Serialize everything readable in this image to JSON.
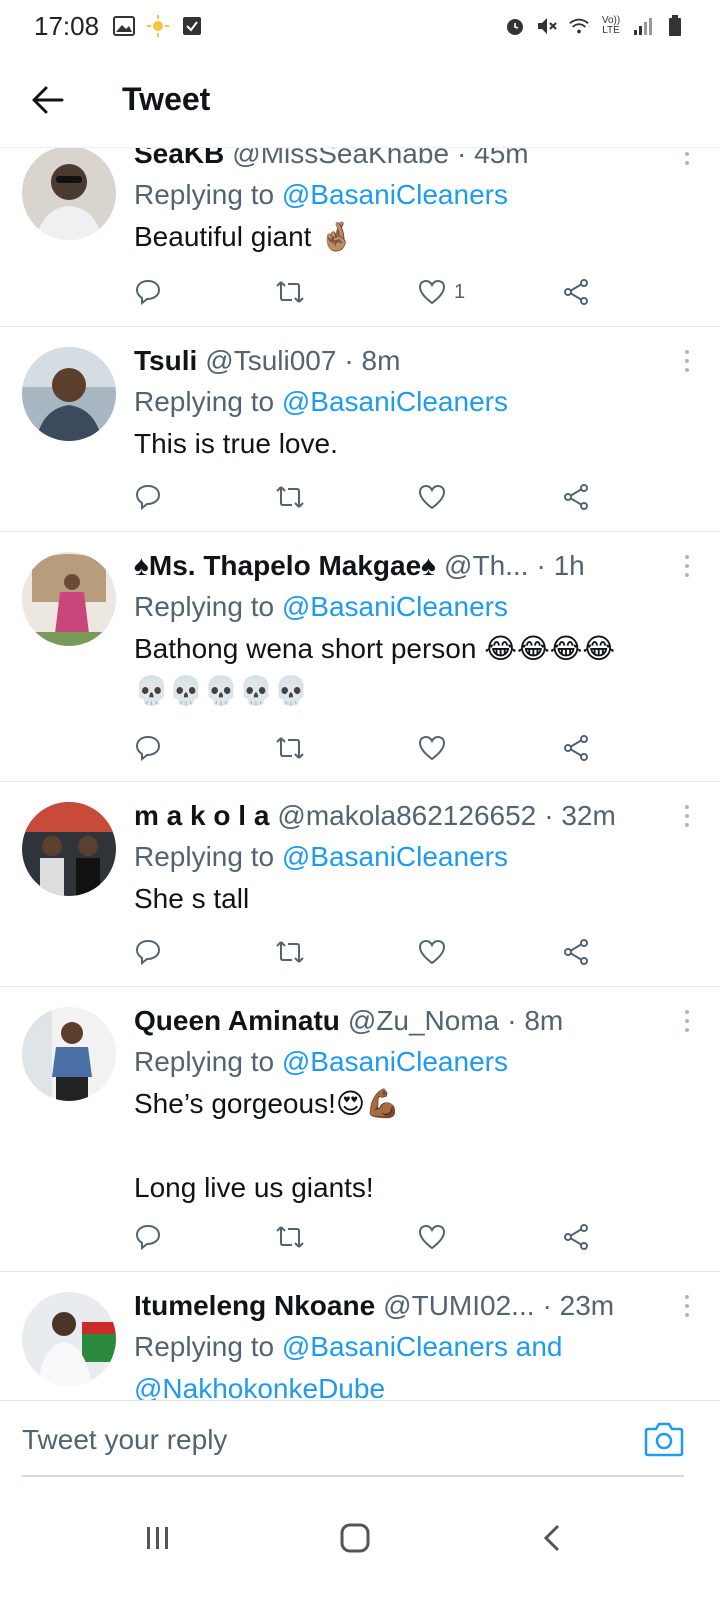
{
  "status_bar": {
    "time": "17:08",
    "left_icons": [
      "image-icon",
      "sun-icon",
      "checkbox-icon"
    ],
    "right_icons": [
      "alarm-icon",
      "mute-icon",
      "wifi-icon",
      "volte-icon",
      "signal-icon",
      "battery-icon"
    ],
    "volte_label": "Vo)) LTE"
  },
  "header": {
    "title": "Tweet"
  },
  "tweets": [
    {
      "name": "SeaKB",
      "handle": "@MissSeaKhabe",
      "time": "· 45m",
      "replying_prefix": "Replying to",
      "replying_to": "@BasaniCleaners",
      "text": "Beautiful giant 🤞🏽",
      "likes": "1",
      "avatar_color": "#5a5048"
    },
    {
      "name": "Tsuli",
      "handle": "@Tsuli007",
      "time": "· 8m",
      "replying_prefix": "Replying to",
      "replying_to": "@BasaniCleaners",
      "text": "This is true love.",
      "likes": "",
      "avatar_color": "#7c8890"
    },
    {
      "name": "♠Ms. Thapelo Makgae♠",
      "handle": "@Th...",
      "time": "· 1h",
      "replying_prefix": "Replying to",
      "replying_to": "@BasaniCleaners",
      "text": "Bathong wena short person 😂😂😂😂\n💀💀💀💀💀",
      "likes": "",
      "avatar_color": "#c9b8a4"
    },
    {
      "name": "m a k o l a",
      "handle": "@makola862126652",
      "time": "· 32m",
      "replying_prefix": "Replying to",
      "replying_to": "@BasaniCleaners",
      "text": "She s tall",
      "likes": "",
      "avatar_color": "#3a3f46"
    },
    {
      "name": "Queen Aminatu",
      "handle": "@Zu_Noma",
      "time": "· 8m",
      "replying_prefix": "Replying to",
      "replying_to": "@BasaniCleaners",
      "text": "She’s gorgeous!😍💪🏾\n\nLong live us giants!",
      "likes": "",
      "avatar_color": "#6b6f75"
    },
    {
      "name": "Itumeleng Nkoane",
      "handle": "@TUMI02...",
      "time": "· 23m",
      "replying_prefix": "Replying to",
      "replying_to": "@BasaniCleaners and",
      "replying_to_2": "@NakhokonkeDube",
      "text": "",
      "likes": "",
      "avatar_color": "#8e9aa6"
    }
  ],
  "reply_bar": {
    "placeholder": "Tweet your reply"
  },
  "nav_bar": {
    "items": [
      "recent-apps",
      "home",
      "back"
    ]
  },
  "colors": {
    "accent": "#1d9bf0",
    "text": "#0f1419",
    "secondary": "#536471"
  }
}
